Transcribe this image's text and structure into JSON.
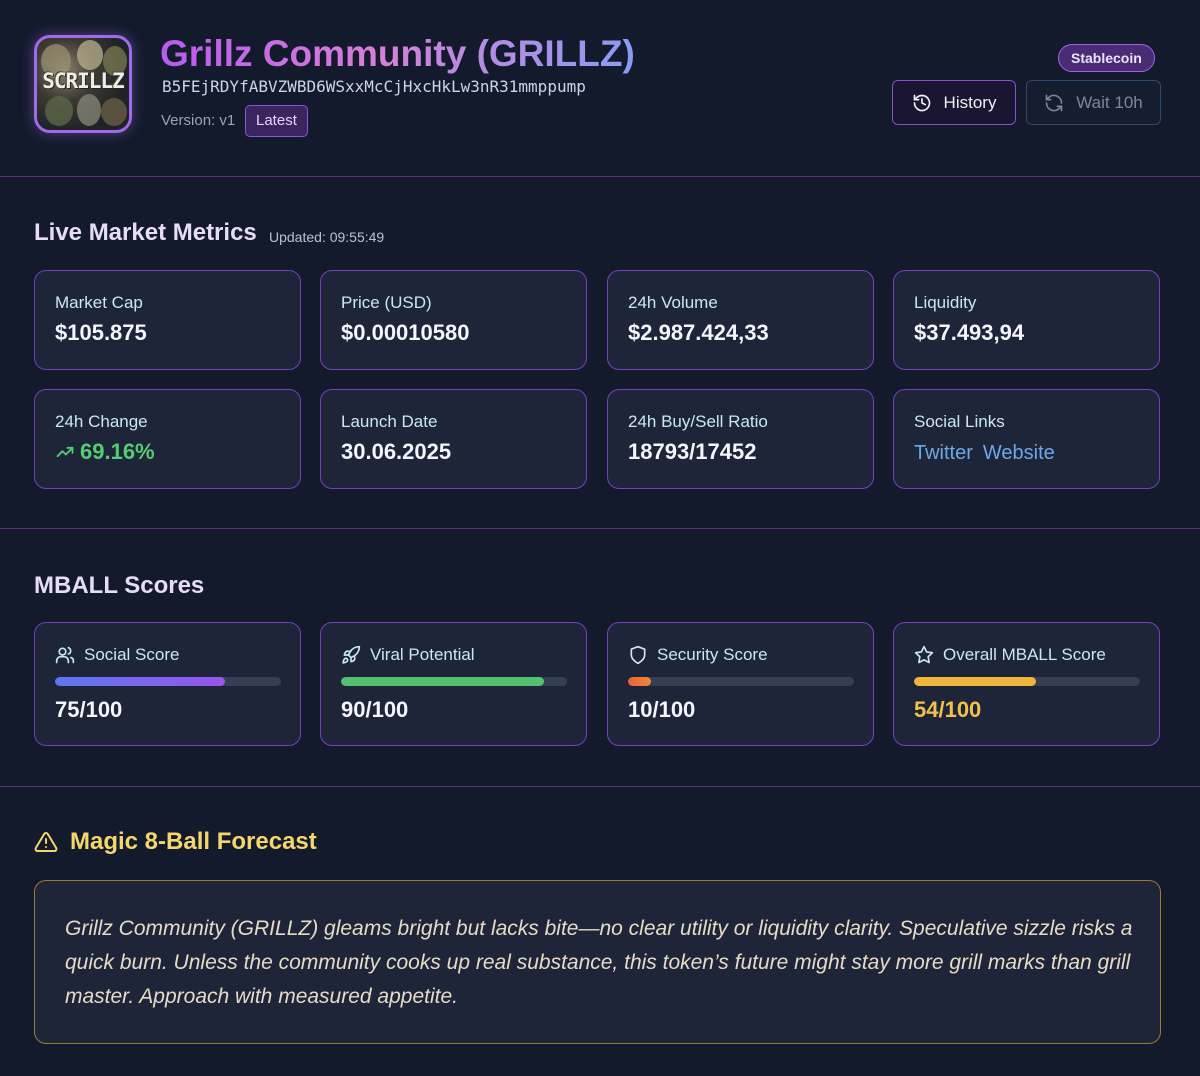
{
  "header": {
    "logo_text": "SCRILLZ",
    "title": "Grillz Community (GRILLZ)",
    "address": "B5FEjRDYfABVZWBD6WSxxMcCjHxcHkLw3nR31mmppump",
    "version_label": "Version: v1",
    "latest_badge": "Latest",
    "category_badge": "Stablecoin",
    "history_button": "History",
    "wait_button": "Wait 10h"
  },
  "market": {
    "title": "Live Market Metrics",
    "updated": "Updated: 09:55:49",
    "cards": [
      {
        "label": "Market Cap",
        "value": "$105.875"
      },
      {
        "label": "Price (USD)",
        "value": "$0.00010580"
      },
      {
        "label": "24h Volume",
        "value": "$2.987.424,33"
      },
      {
        "label": "Liquidity",
        "value": "$37.493,94"
      },
      {
        "label": "24h Change",
        "value": "69.16%"
      },
      {
        "label": "Launch Date",
        "value": "30.06.2025"
      },
      {
        "label": "24h Buy/Sell Ratio",
        "value": "18793/17452"
      },
      {
        "label": "Social Links",
        "links": [
          "Twitter",
          "Website"
        ]
      }
    ]
  },
  "scores": {
    "title": "MBALL Scores",
    "items": [
      {
        "label": "Social Score",
        "value": "75/100",
        "level": 0.75,
        "icon": "users-icon"
      },
      {
        "label": "Viral Potential",
        "value": "90/100",
        "level": 0.9,
        "icon": "rocket-icon"
      },
      {
        "label": "Security Score",
        "value": "10/100",
        "level": 0.1,
        "icon": "shield-icon"
      },
      {
        "label": "Overall MBALL Score",
        "value": "54/100",
        "level": 0.54,
        "icon": "star-icon"
      }
    ]
  },
  "forecast": {
    "title": "Magic 8-Ball Forecast",
    "text": "Grillz Community (GRILLZ) gleams bright but lacks bite—no clear utility or liquidity clarity. Speculative sizzle risks a quick burn. Unless the community cooks up real substance, this token’s future might stay more grill marks than grill master. Approach with measured appetite."
  },
  "colors": {
    "background": "#131a2c",
    "accent_purple": "#7440c0",
    "positive_green": "#55cc74",
    "link_blue": "#6ca8e8",
    "warning_gold": "#f4d76a",
    "social_bar": "#6f68ec",
    "viral_bar": "#55c070",
    "security_bar": "#e8623a",
    "overall_bar": "#f0b638"
  }
}
